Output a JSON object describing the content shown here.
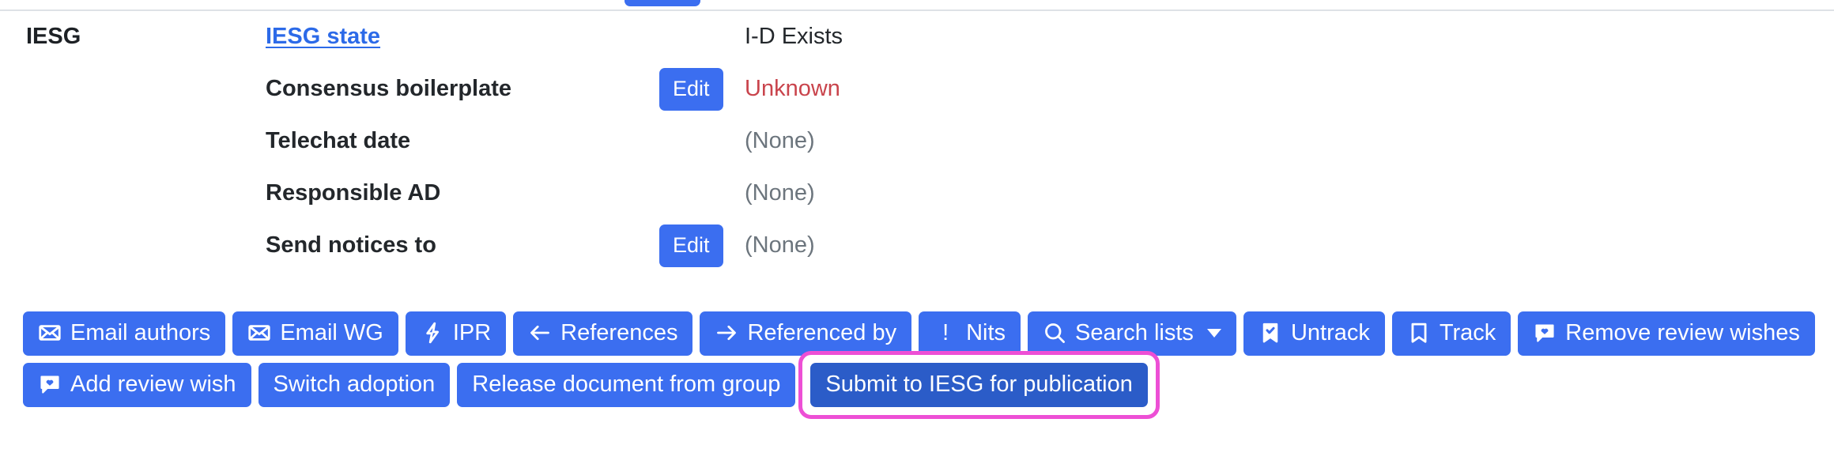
{
  "meta": {
    "group_label": "IESG",
    "rows": [
      {
        "label": "IESG state",
        "is_link": true,
        "edit_label": null,
        "value": "I-D Exists",
        "value_style": "normal"
      },
      {
        "label": "Consensus boilerplate",
        "is_link": false,
        "edit_label": "Edit",
        "value": "Unknown",
        "value_style": "danger"
      },
      {
        "label": "Telechat date",
        "is_link": false,
        "edit_label": null,
        "value": "(None)",
        "value_style": "muted"
      },
      {
        "label": "Responsible AD",
        "is_link": false,
        "edit_label": null,
        "value": "(None)",
        "value_style": "muted"
      },
      {
        "label": "Send notices to",
        "is_link": false,
        "edit_label": "Edit",
        "value": "(None)",
        "value_style": "muted"
      }
    ]
  },
  "actions": {
    "row1": [
      {
        "label": "Email authors",
        "icon": "envelope-icon"
      },
      {
        "label": "Email WG",
        "icon": "envelope-icon"
      },
      {
        "label": "IPR",
        "icon": "lightning-bolt-icon"
      },
      {
        "label": "References",
        "icon": "arrow-left-icon"
      },
      {
        "label": "Referenced by",
        "icon": "arrow-right-icon"
      },
      {
        "label": "Nits",
        "icon": "exclamation-icon"
      },
      {
        "label": "Search lists",
        "icon": "search-icon",
        "caret": true
      },
      {
        "label": "Untrack",
        "icon": "bookmark-check-icon"
      },
      {
        "label": "Track",
        "icon": "bookmark-icon"
      },
      {
        "label": "Remove review wishes",
        "icon": "chat-heart-icon"
      }
    ],
    "row2": [
      {
        "label": "Add review wish",
        "icon": "chat-heart-icon"
      },
      {
        "label": "Switch adoption",
        "icon": null
      },
      {
        "label": "Release document from group",
        "icon": null
      }
    ],
    "highlighted": {
      "label": "Submit to IESG for publication",
      "icon": null
    }
  },
  "colors": {
    "primary": "#3b6ef0",
    "primary_active": "#2b5cc8",
    "highlight_ring": "#ed4fd5",
    "link": "#2c6ae8",
    "danger": "#c9444c",
    "muted": "#6c757d",
    "divider": "#dee2e6"
  }
}
